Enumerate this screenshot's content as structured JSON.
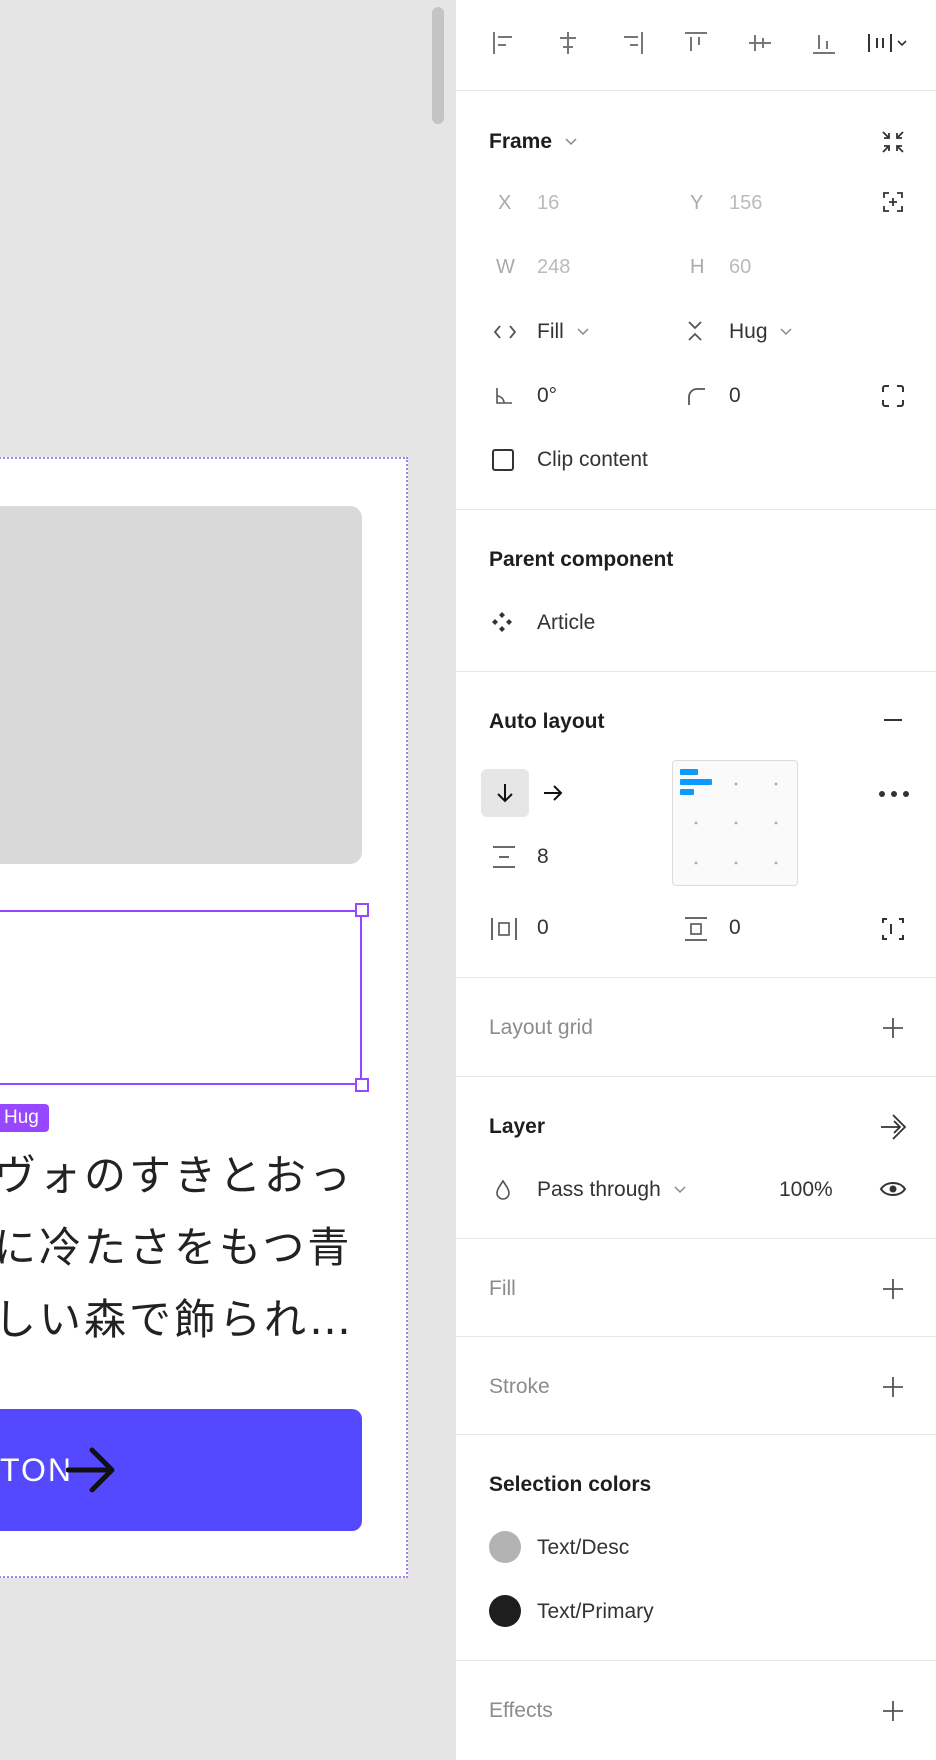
{
  "canvas": {
    "hug_badge": "Hug",
    "description_lines": [
      "ヴォのすきとおっ",
      "に冷たさをもつ青",
      "しい森で飾られ…"
    ],
    "button_label": "TON"
  },
  "frame": {
    "title": "Frame",
    "x_label": "X",
    "x_value": "16",
    "y_label": "Y",
    "y_value": "156",
    "w_label": "W",
    "w_value": "248",
    "h_label": "H",
    "h_value": "60",
    "width_mode": "Fill",
    "height_mode": "Hug",
    "rotation": "0°",
    "corner_radius": "0",
    "clip_content_label": "Clip content",
    "clip_content_checked": false
  },
  "parent_component": {
    "title": "Parent component",
    "name": "Article"
  },
  "auto_layout": {
    "title": "Auto layout",
    "direction": "vertical",
    "spacing": "8",
    "horizontal_padding": "0",
    "vertical_padding": "0",
    "alignment": "top-left"
  },
  "layout_grid": {
    "title": "Layout grid"
  },
  "layer": {
    "title": "Layer",
    "blend_mode": "Pass through",
    "opacity": "100%"
  },
  "fill": {
    "title": "Fill"
  },
  "stroke": {
    "title": "Stroke"
  },
  "selection_colors": {
    "title": "Selection colors",
    "items": [
      {
        "name": "Text/Desc",
        "color": "#b3b3b3"
      },
      {
        "name": "Text/Primary",
        "color": "#1e1e1e"
      }
    ]
  },
  "effects": {
    "title": "Effects"
  },
  "colors": {
    "accent": "#9747ff",
    "button": "#5549ff",
    "active_blue": "#0d99ff"
  }
}
